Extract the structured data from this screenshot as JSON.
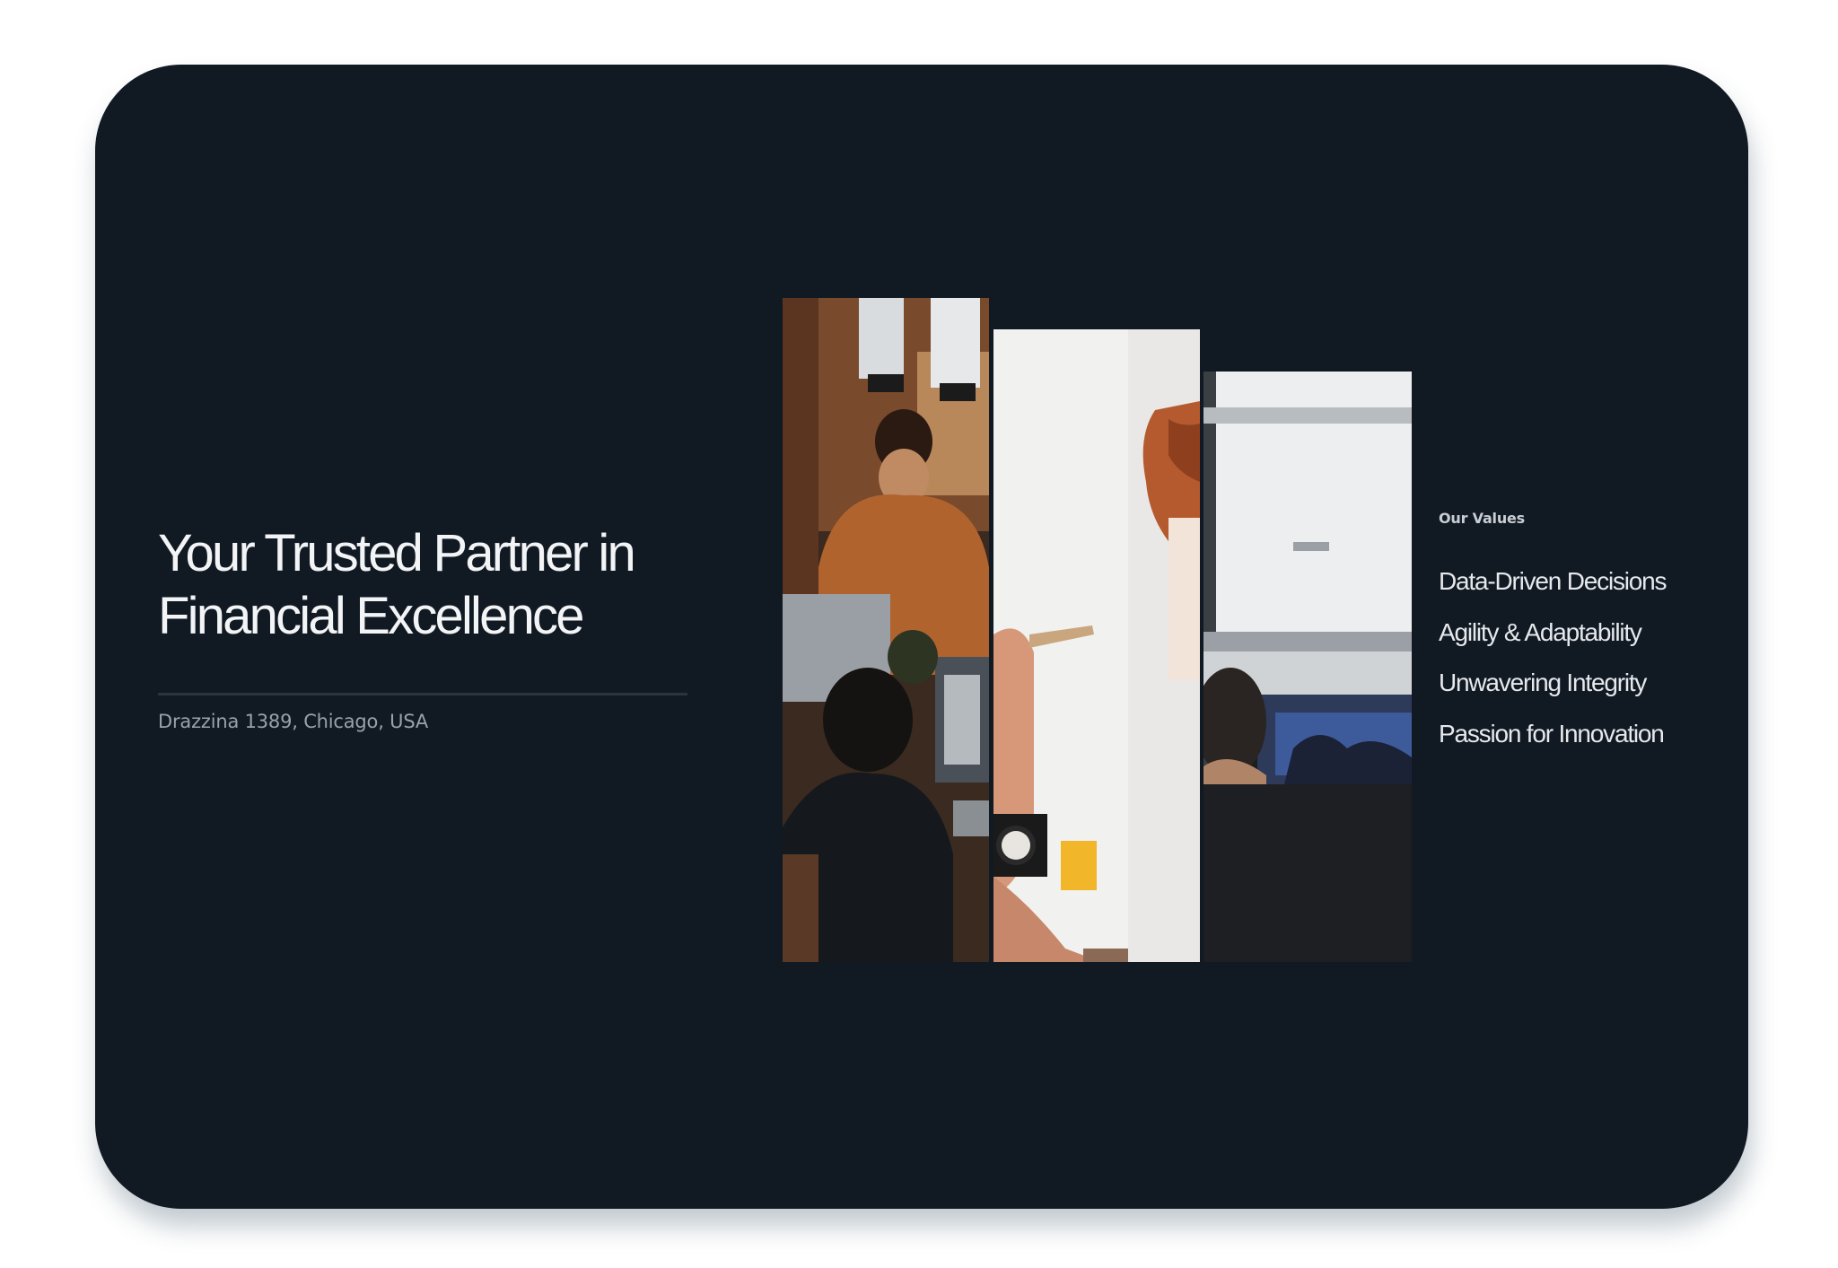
{
  "slide": {
    "headline_line1": "Your Trusted Partner in",
    "headline_line2": "Financial Excellence",
    "address": "Drazzina 1389, Chicago, USA",
    "values_label": "Our Values",
    "values": [
      "Data-Driven Decisions",
      "Agility & Adaptability",
      "Unwavering Integrity",
      "Passion for Innovation"
    ],
    "photos": [
      "team-at-work-photo",
      "hand-with-pen-photo",
      "office-window-photo"
    ]
  },
  "colors": {
    "page_background": "#ffffff",
    "slide_background": "#111923",
    "headline_text": "#f2f4f6",
    "muted_text": "#9aa1a8",
    "divider": "#2a3440"
  }
}
